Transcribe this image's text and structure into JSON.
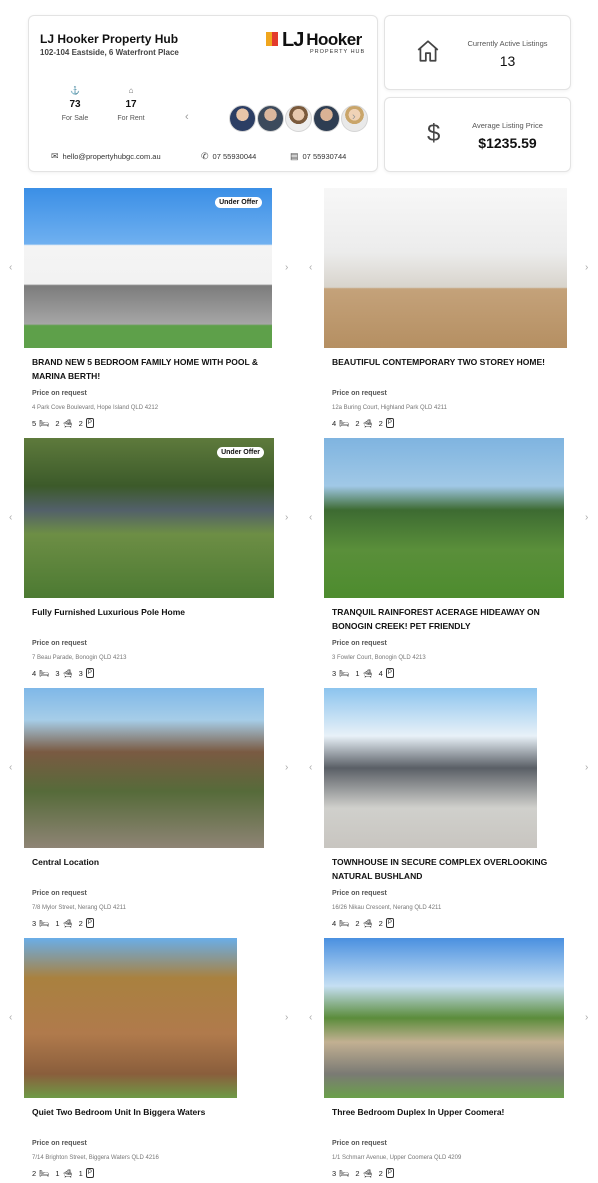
{
  "hub": {
    "name": "LJ Hooker Property Hub",
    "address": "102-104 Eastside, 6 Waterfront Place",
    "logo_text": "LJ Hooker",
    "logo_sub": "PROPERTY HUB",
    "for_sale_count": "73",
    "for_sale_label": "For Sale",
    "for_rent_count": "17",
    "for_rent_label": "For Rent",
    "email": "hello@propertyhubgc.com.au",
    "phone": "07 55930044",
    "fax": "07 55930744"
  },
  "kpis": {
    "active_label": "Currently Active Listings",
    "active_value": "13",
    "price_label": "Average Listing Price",
    "price_value": "$1235.59"
  },
  "listings": [
    {
      "title": "BRAND NEW 5 BEDROOM FAMILY HOME WITH POOL & MARINA BERTH!",
      "price": "Price on request",
      "address": "4 Park Cove Boulevard, Hope Island QLD 4212",
      "beds": "5",
      "baths": "2",
      "cars": "2",
      "badge": "Under Offer"
    },
    {
      "title": "BEAUTIFUL CONTEMPORARY TWO STOREY HOME!",
      "price": "Price on request",
      "address": "12a Buring Court, Highland Park QLD 4211",
      "beds": "4",
      "baths": "2",
      "cars": "2",
      "badge": ""
    },
    {
      "title": "Fully Furnished Luxurious Pole Home",
      "price": "Price on request",
      "address": "7 Beau Parade, Bonogin QLD 4213",
      "beds": "4",
      "baths": "3",
      "cars": "3",
      "badge": "Under Offer"
    },
    {
      "title": "TRANQUIL RAINFOREST ACERAGE HIDEAWAY ON BONOGIN CREEK! PET FRIENDLY",
      "price": "Price on request",
      "address": "3 Fowler Court, Bonogin QLD 4213",
      "beds": "3",
      "baths": "1",
      "cars": "4",
      "badge": ""
    },
    {
      "title": "Central Location",
      "price": "Price on request",
      "address": "7/8 Mylor Street, Nerang QLD 4211",
      "beds": "3",
      "baths": "1",
      "cars": "2",
      "badge": ""
    },
    {
      "title": "TOWNHOUSE IN SECURE COMPLEX OVERLOOKING NATURAL BUSHLAND",
      "price": "Price on request",
      "address": "16/26 Nikau Crescent, Nerang QLD 4211",
      "beds": "4",
      "baths": "2",
      "cars": "2",
      "badge": ""
    },
    {
      "title": "Quiet Two Bedroom Unit In Biggera Waters",
      "price": "Price on request",
      "address": "7/14 Brighton Street, Biggera Waters QLD 4216",
      "beds": "2",
      "baths": "1",
      "cars": "1",
      "badge": ""
    },
    {
      "title": "Three Bedroom Duplex In Upper Coomera!",
      "price": "Price on request",
      "address": "1/1 Schmarr Avenue, Upper Coomera QLD 4209",
      "beds": "3",
      "baths": "2",
      "cars": "2",
      "badge": ""
    }
  ],
  "colors": {
    "logo_yellow": "#f0a61e",
    "logo_red": "#e33a2c"
  }
}
